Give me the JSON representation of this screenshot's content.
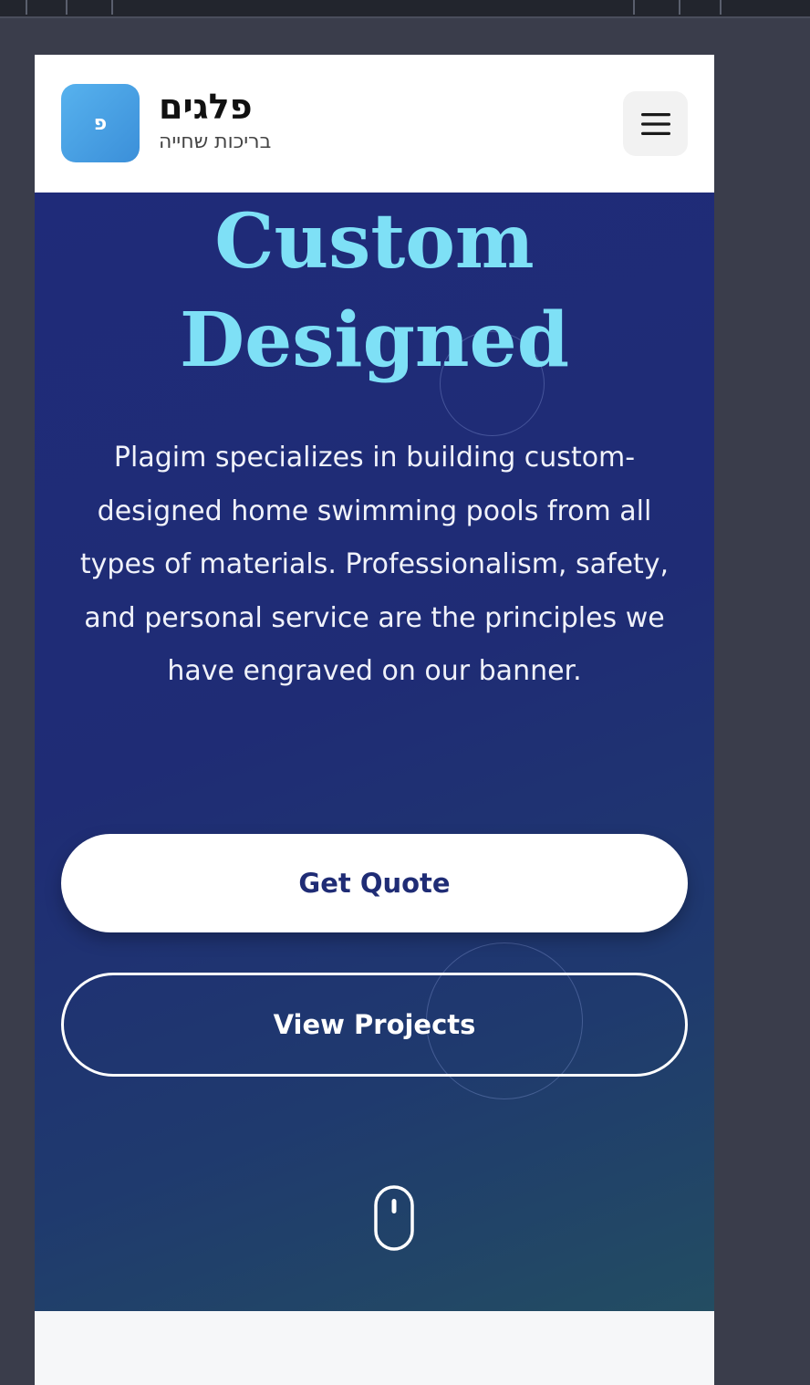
{
  "header": {
    "logo_letter": "פ",
    "brand_name": "פלגים",
    "brand_tagline": "בריכות שחייה",
    "menu_icon": "hamburger-menu-icon"
  },
  "hero": {
    "title_line1": "Custom",
    "title_line2": "Designed",
    "description": "Plagim specializes in building custom-designed home swimming pools from all types of materials. Professionalism, safety, and personal service are the principles we have engraved on our banner.",
    "primary_button": "Get Quote",
    "secondary_button": "View Projects",
    "scroll_icon": "mouse-scroll-icon"
  },
  "colors": {
    "hero_gradient_start": "#1f2b79",
    "hero_gradient_end": "#234d62",
    "title_accent": "#7ee0f6",
    "logo_gradient_start": "#57b2ee",
    "logo_gradient_end": "#3b8fd9",
    "primary_button_text": "#1f2c75"
  }
}
